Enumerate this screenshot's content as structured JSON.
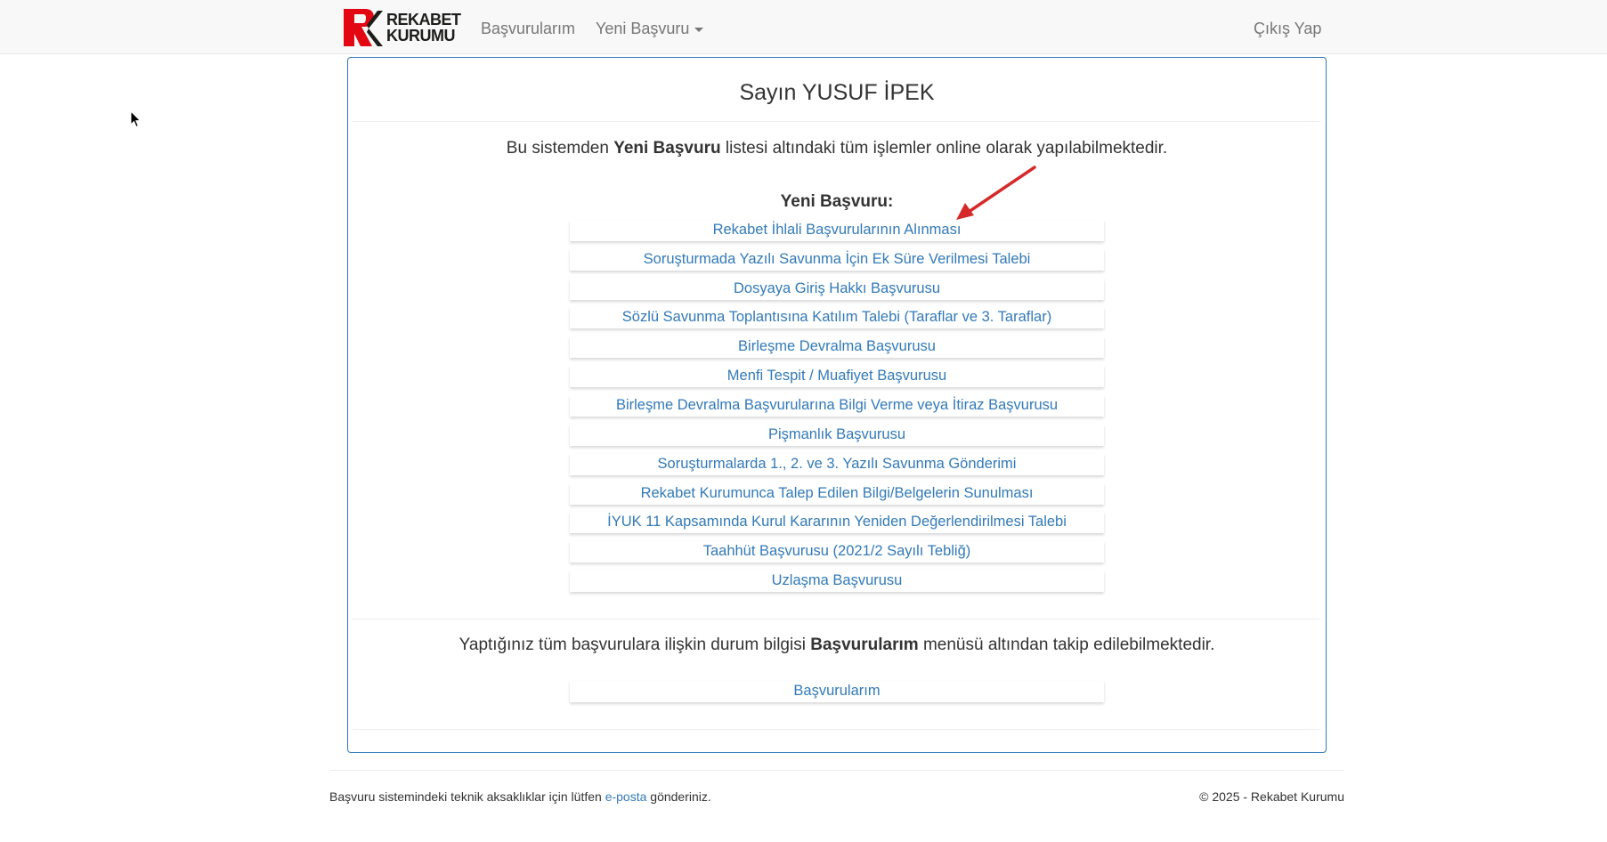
{
  "brand": {
    "line1": "REKABET",
    "line2": "KURUMU"
  },
  "nav": {
    "basvurularim": "Başvurularım",
    "yeni_basvuru": "Yeni Başvuru",
    "logout": "Çıkış Yap"
  },
  "panel": {
    "greeting": "Sayın YUSUF İPEK",
    "intro_prefix": "Bu sistemden ",
    "intro_bold": "Yeni Başvuru",
    "intro_suffix": " listesi altındaki tüm işlemler online olarak yapılabilmektedir.",
    "section_title": "Yeni Başvuru:",
    "items": [
      {
        "label": "Rekabet İhlali Başvurularının Alınması"
      },
      {
        "label": "Soruşturmada Yazılı Savunma İçin Ek Süre Verilmesi Talebi"
      },
      {
        "label": "Dosyaya Giriş Hakkı Başvurusu"
      },
      {
        "label": "Sözlü Savunma Toplantısına Katılım Talebi (Taraflar ve 3. Taraflar)"
      },
      {
        "label": "Birleşme Devralma Başvurusu"
      },
      {
        "label": "Menfi Tespit / Muafiyet Başvurusu"
      },
      {
        "label": "Birleşme Devralma Başvurularına Bilgi Verme veya İtiraz Başvurusu"
      },
      {
        "label": "Pişmanlık Başvurusu"
      },
      {
        "label": "Soruşturmalarda 1., 2. ve 3. Yazılı Savunma Gönderimi"
      },
      {
        "label": "Rekabet Kurumunca Talep Edilen Bilgi/Belgelerin Sunulması"
      },
      {
        "label": "İYUK 11 Kapsamında Kurul Kararının Yeniden Değerlendirilmesi Talebi"
      },
      {
        "label": "Taahhüt Başvurusu (2021/2 Sayılı Tebliğ)"
      },
      {
        "label": "Uzlaşma Başvurusu"
      }
    ],
    "status_prefix": "Yaptığınız tüm başvurulara ilişkin durum bilgisi ",
    "status_bold": "Başvurularım",
    "status_suffix": " menüsü altından takip edilebilmektedir.",
    "basvurularim_button": "Başvurularım"
  },
  "footer": {
    "left_prefix": "Başvuru sistemindeki teknik aksaklıklar için lütfen ",
    "left_link": "e-posta",
    "left_suffix": " gönderiniz.",
    "right": "© 2025 - Rekabet Kurumu"
  },
  "colors": {
    "link": "#337ab7",
    "brand_red": "#e30613",
    "panel_border": "#337ab7",
    "annotation_arrow": "#d42a2a"
  },
  "icons": {
    "brand_logo": "rk-logo",
    "caret": "caret-down-icon",
    "cursor": "mouse-pointer-icon",
    "annotation": "red-arrow-icon"
  }
}
